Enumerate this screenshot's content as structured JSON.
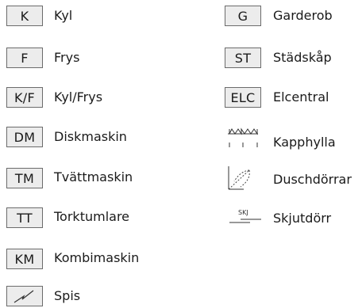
{
  "legend": {
    "left": [
      {
        "code": "K",
        "label": "Kyl"
      },
      {
        "code": "F",
        "label": "Frys"
      },
      {
        "code": "K/F",
        "label": "Kyl/Frys"
      },
      {
        "code": "DM",
        "label": "Diskmaskin"
      },
      {
        "code": "TM",
        "label": "Tvättmaskin"
      },
      {
        "code": "TT",
        "label": "Torktumlare"
      },
      {
        "code": "KM",
        "label": "Kombimaskin"
      },
      {
        "code": "",
        "label": "Spis",
        "icon": "stove-icon"
      }
    ],
    "right": [
      {
        "code": "G",
        "label": "Garderob"
      },
      {
        "code": "ST",
        "label": "Städskåp"
      },
      {
        "code": "ELC",
        "label": "Elcentral"
      },
      {
        "code": "",
        "label": "Kapphylla",
        "icon": "coat-rack-icon"
      },
      {
        "code": "",
        "label": "Duschdörrar",
        "icon": "shower-door-icon"
      },
      {
        "code": "",
        "label": "Skjutdörr",
        "icon": "sliding-door-icon",
        "icon_text": "SKJ"
      }
    ]
  },
  "colors": {
    "box_fill": "#ececec",
    "box_border": "#6b6b6b",
    "text": "#1a1a1a"
  }
}
